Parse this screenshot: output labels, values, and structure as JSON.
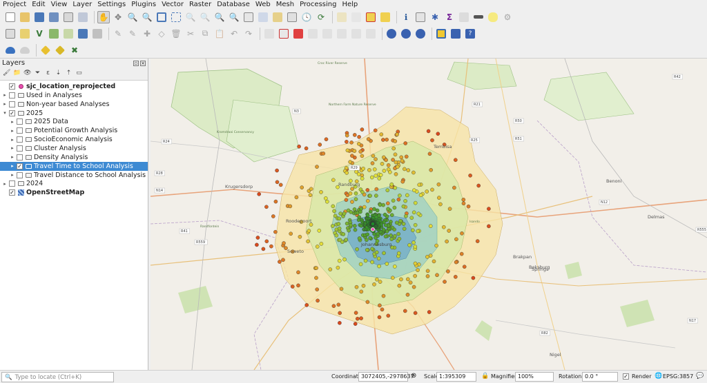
{
  "menubar": {
    "items": [
      "Project",
      "Edit",
      "View",
      "Layer",
      "Settings",
      "Plugins",
      "Vector",
      "Raster",
      "Database",
      "Web",
      "Mesh",
      "Processing",
      "Help"
    ]
  },
  "layers_panel": {
    "title": "Layers",
    "items": [
      {
        "label": "sjc_location_reprojected",
        "checked": true,
        "bold": true,
        "indent": 0,
        "expander": "",
        "icon": "point-layer-icon"
      },
      {
        "label": "Used in Analyses",
        "checked": false,
        "bold": false,
        "indent": 0,
        "expander": "▸",
        "icon": "group-icon"
      },
      {
        "label": "Non-year based Analyses",
        "checked": false,
        "bold": false,
        "indent": 0,
        "expander": "▸",
        "icon": "group-icon"
      },
      {
        "label": "2025",
        "checked": true,
        "bold": false,
        "indent": 0,
        "expander": "▾",
        "icon": "group-icon"
      },
      {
        "label": "2025 Data",
        "checked": false,
        "bold": false,
        "indent": 1,
        "expander": "▸",
        "icon": "group-icon"
      },
      {
        "label": "Potential Growth Analysis",
        "checked": false,
        "bold": false,
        "indent": 1,
        "expander": "▸",
        "icon": "group-icon"
      },
      {
        "label": "SocioEconomic Analysis",
        "checked": false,
        "bold": false,
        "indent": 1,
        "expander": "▸",
        "icon": "group-icon"
      },
      {
        "label": "Cluster Analysis",
        "checked": false,
        "bold": false,
        "indent": 1,
        "expander": "▸",
        "icon": "group-icon"
      },
      {
        "label": "Density Analysis",
        "checked": false,
        "bold": false,
        "indent": 1,
        "expander": "▸",
        "icon": "group-icon"
      },
      {
        "label": "Travel Time to School Analysis",
        "checked": true,
        "bold": false,
        "indent": 1,
        "expander": "▸",
        "icon": "group-icon",
        "selected": true
      },
      {
        "label": "Travel Distance to School Analysis",
        "checked": false,
        "bold": false,
        "indent": 1,
        "expander": "▸",
        "icon": "group-icon"
      },
      {
        "label": "2024",
        "checked": false,
        "bold": false,
        "indent": 0,
        "expander": "▸",
        "icon": "group-icon"
      },
      {
        "label": "OpenStreetMap",
        "checked": true,
        "bold": true,
        "indent": 0,
        "expander": "",
        "icon": "tile-layer-icon"
      }
    ]
  },
  "map_labels": {
    "city": "Johannesburg",
    "places": [
      "Krugersdorp",
      "Roodepoort",
      "Soweto",
      "Randburg",
      "Tembisa",
      "Benoni",
      "Boksburg",
      "Springs",
      "Brakpan",
      "Nigel",
      "Delmas",
      "Randfontein",
      "Croc River Reserve",
      "Kromdraai Conservancy",
      "Northern Farm Nature Reserve",
      "Isando"
    ],
    "roads": [
      "N14",
      "R28",
      "R41",
      "R559",
      "R24",
      "R21",
      "R25",
      "R50",
      "R51",
      "R42",
      "N12",
      "R555",
      "N3",
      "R82",
      "N17",
      "R29"
    ]
  },
  "statusbar": {
    "locator_placeholder": "Type to locate (Ctrl+K)",
    "coordinate_label": "Coordinate",
    "coordinate_value": "3072405,-2978637",
    "scale_label": "Scale",
    "scale_value": "1:395309",
    "magnifier_label": "Magnifier",
    "magnifier_value": "100%",
    "rotation_label": "Rotation",
    "rotation_value": "0.0 °",
    "render_label": "Render",
    "crs_label": "EPSG:3857"
  },
  "colors": {
    "accent_selection": "#3d8ad3",
    "isochrone_outer": "#f6e4a6",
    "isochrone_mid": "#d8e8a8",
    "isochrone_inner": "#9ecfc4",
    "isochrone_core": "#6fa9c9",
    "point_near": "#1f8a2a",
    "point_mid": "#e4e23a",
    "point_far": "#d9441c"
  }
}
